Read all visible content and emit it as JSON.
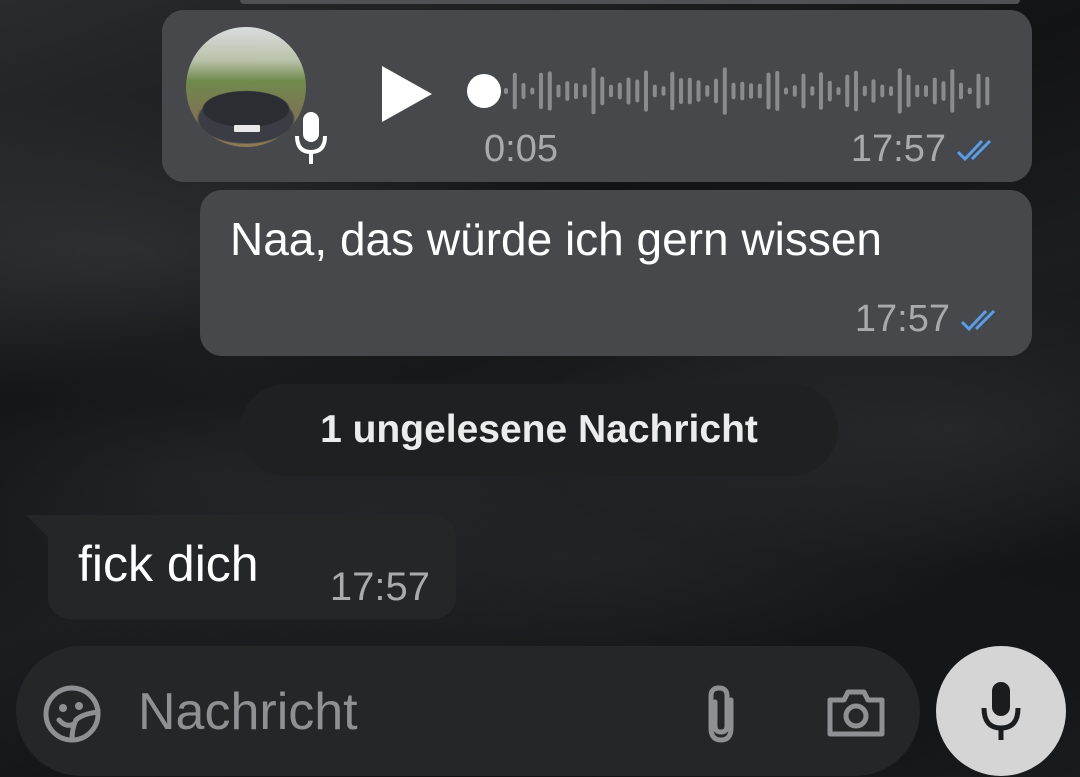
{
  "colors": {
    "outgoing_bubble": "#47484b",
    "incoming_bubble": "#242628",
    "read_ticks": "#5a9ee8",
    "mic_button_bg": "#d5d5d5"
  },
  "icons": {
    "play": "play-icon",
    "mic_badge": "microphone-icon",
    "read_receipt": "double-check-icon",
    "emoji": "sticker-emoji-icon",
    "attach": "paperclip-icon",
    "camera": "camera-icon",
    "mic": "microphone-icon"
  },
  "messages": {
    "voice": {
      "duration": "0:05",
      "time": "17:57",
      "progress": 0.0
    },
    "outgoing_text": {
      "text": "Naa, das würde ich gern wissen",
      "time": "17:57"
    },
    "unread_divider": "1 ungelesene Nachricht",
    "incoming_text": {
      "text": "fick dich",
      "time": "17:57"
    }
  },
  "composer": {
    "placeholder": "Nachricht",
    "value": ""
  }
}
